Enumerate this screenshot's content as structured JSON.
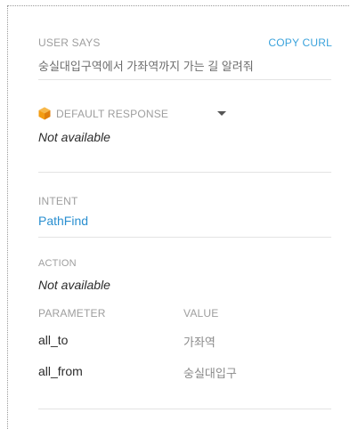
{
  "user_says": {
    "label": "USER SAYS",
    "copy_curl_label": "COPY CURL",
    "query": "숭실대입구역에서 가좌역까지 가는 길 알려줘"
  },
  "default_response": {
    "label": "DEFAULT RESPONSE",
    "value": "Not available",
    "icon": "orange-hexagon-icon",
    "icon_color": "#f39c12"
  },
  "intent": {
    "label": "INTENT",
    "value": "PathFind"
  },
  "action": {
    "label": "ACTION",
    "value": "Not available"
  },
  "parameters": {
    "header_name": "PARAMETER",
    "header_value": "VALUE",
    "rows": [
      {
        "name": "all_to",
        "value": "가좌역"
      },
      {
        "name": "all_from",
        "value": "숭실대입구"
      }
    ]
  },
  "colors": {
    "accent": "#3ba3dc",
    "link": "#2a8fd0",
    "label": "#9e9e9e"
  }
}
